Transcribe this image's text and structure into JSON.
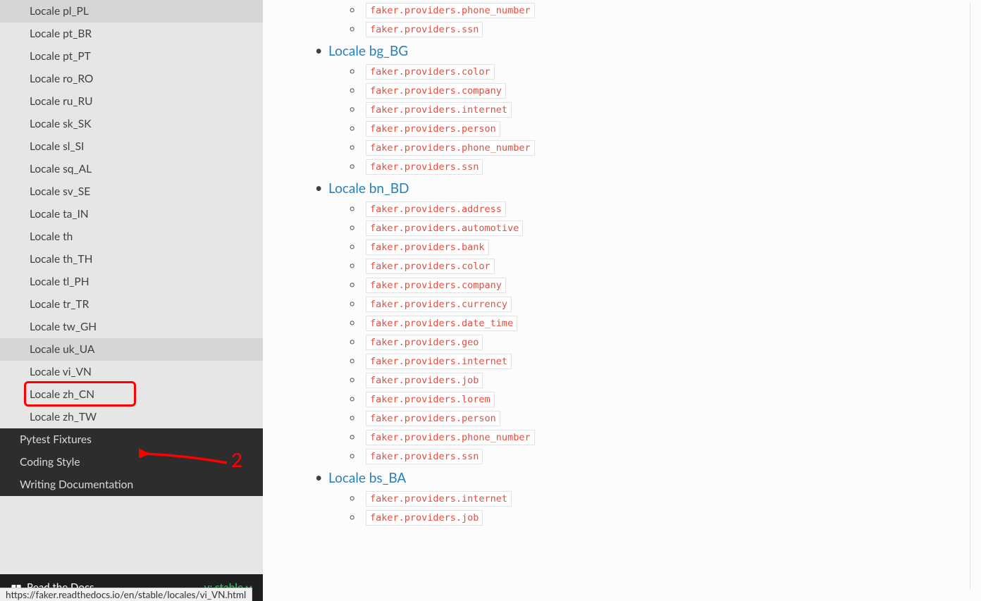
{
  "sidebar": {
    "locales": [
      "Locale pl_PL",
      "Locale pt_BR",
      "Locale pt_PT",
      "Locale ro_RO",
      "Locale ru_RU",
      "Locale sk_SK",
      "Locale sl_SI",
      "Locale sq_AL",
      "Locale sv_SE",
      "Locale ta_IN",
      "Locale th",
      "Locale th_TH",
      "Locale tl_PH",
      "Locale tr_TR",
      "Locale tw_GH",
      "Locale uk_UA",
      "Locale vi_VN",
      "Locale zh_CN",
      "Locale zh_TW"
    ],
    "hoveredIndex": 15,
    "highlightedIndex": 17,
    "sections": [
      "Pytest Fixtures",
      "Coding Style",
      "Writing Documentation"
    ]
  },
  "rtd": {
    "label": "Read the Docs",
    "version": "v: stable"
  },
  "content": {
    "initialProviders": [
      "faker.providers.phone_number",
      "faker.providers.ssn"
    ],
    "groups": [
      {
        "title": "Locale bg_BG",
        "providers": [
          "faker.providers.color",
          "faker.providers.company",
          "faker.providers.internet",
          "faker.providers.person",
          "faker.providers.phone_number",
          "faker.providers.ssn"
        ]
      },
      {
        "title": "Locale bn_BD",
        "providers": [
          "faker.providers.address",
          "faker.providers.automotive",
          "faker.providers.bank",
          "faker.providers.color",
          "faker.providers.company",
          "faker.providers.currency",
          "faker.providers.date_time",
          "faker.providers.geo",
          "faker.providers.internet",
          "faker.providers.job",
          "faker.providers.lorem",
          "faker.providers.person",
          "faker.providers.phone_number",
          "faker.providers.ssn"
        ]
      },
      {
        "title": "Locale bs_BA",
        "providers": [
          "faker.providers.internet",
          "faker.providers.job"
        ]
      }
    ]
  },
  "annotation": {
    "label": "2"
  },
  "status": {
    "url": "https://faker.readthedocs.io/en/stable/locales/vi_VN.html"
  }
}
